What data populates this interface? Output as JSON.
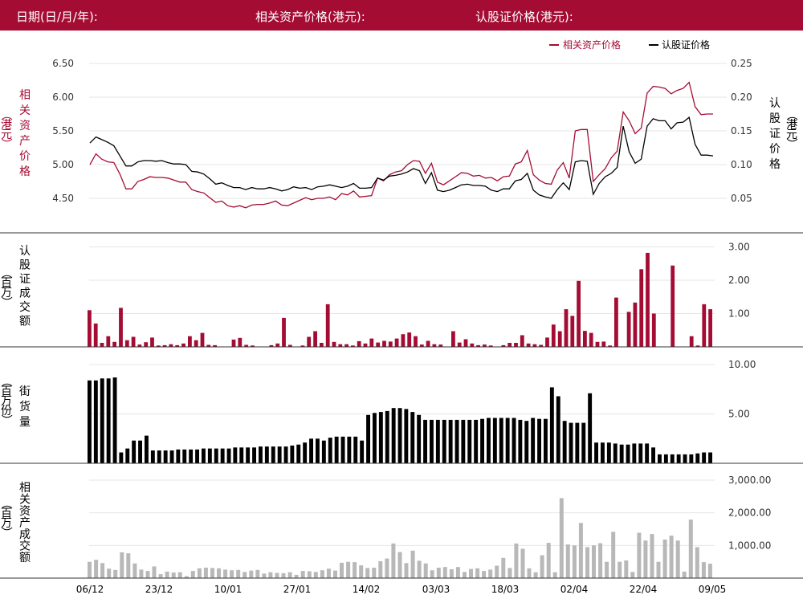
{
  "header": {
    "date_label": "日期(日/月/年):",
    "asset_price_label": "相关资产价格(港元):",
    "warrant_price_label": "认股证价格(港元):"
  },
  "colors": {
    "header_bg": "#a50c34",
    "asset": "#a50c34",
    "warrant": "#000000",
    "turnover_asset": "#b8b8b8",
    "grid": "#e6e6e6"
  },
  "chart_data": [
    {
      "type": "line",
      "title": "",
      "legend": [
        "相关资产价格",
        "认股证价格"
      ],
      "legend_position": "top-right",
      "ylabel_left": "相关资产价格（港元）",
      "ylabel_right": "认股证价格（港元）",
      "yticks_left": [
        "6.50",
        "6.00",
        "5.50",
        "5.00",
        "4.50"
      ],
      "yticks_right": [
        "0.25",
        "0.20",
        "0.15",
        "0.10",
        "0.05"
      ],
      "ylim_left": [
        4.2,
        6.6
      ],
      "ylim_right": [
        0.02,
        0.26
      ],
      "series": [
        {
          "name": "相关资产价格",
          "axis": "left",
          "color": "#a50c34",
          "values": [
            5.0,
            5.16,
            5.08,
            5.04,
            5.03,
            4.86,
            4.64,
            4.64,
            4.75,
            4.78,
            4.82,
            4.81,
            4.81,
            4.8,
            4.77,
            4.74,
            4.74,
            4.63,
            4.6,
            4.58,
            4.51,
            4.44,
            4.46,
            4.39,
            4.37,
            4.39,
            4.36,
            4.4,
            4.41,
            4.41,
            4.43,
            4.46,
            4.4,
            4.39,
            4.43,
            4.47,
            4.51,
            4.48,
            4.5,
            4.5,
            4.52,
            4.48,
            4.57,
            4.55,
            4.61,
            4.52,
            4.53,
            4.54,
            4.8,
            4.76,
            4.85,
            4.89,
            4.91,
            5.0,
            5.06,
            5.05,
            4.87,
            5.02,
            4.74,
            4.7,
            4.76,
            4.82,
            4.88,
            4.87,
            4.83,
            4.84,
            4.8,
            4.81,
            4.76,
            4.82,
            4.83,
            5.01,
            5.04,
            5.21,
            4.85,
            4.77,
            4.72,
            4.71,
            4.92,
            5.03,
            4.8,
            5.5,
            5.52,
            5.52,
            4.75,
            4.85,
            4.94,
            5.1,
            5.2,
            5.78,
            5.65,
            5.46,
            5.54,
            6.06,
            6.16,
            6.15,
            6.13,
            6.05,
            6.1,
            6.13,
            6.22,
            5.86,
            5.74,
            5.75,
            5.75
          ]
        },
        {
          "name": "认股证价格",
          "axis": "right",
          "color": "#000000",
          "values": [
            0.132,
            0.141,
            0.137,
            0.133,
            0.128,
            0.113,
            0.098,
            0.098,
            0.104,
            0.106,
            0.106,
            0.105,
            0.106,
            0.103,
            0.101,
            0.101,
            0.1,
            0.09,
            0.089,
            0.086,
            0.079,
            0.071,
            0.073,
            0.069,
            0.066,
            0.066,
            0.063,
            0.066,
            0.064,
            0.064,
            0.066,
            0.064,
            0.061,
            0.063,
            0.067,
            0.065,
            0.066,
            0.063,
            0.067,
            0.068,
            0.07,
            0.068,
            0.066,
            0.068,
            0.072,
            0.065,
            0.065,
            0.066,
            0.08,
            0.077,
            0.083,
            0.084,
            0.086,
            0.089,
            0.094,
            0.091,
            0.072,
            0.088,
            0.062,
            0.06,
            0.062,
            0.066,
            0.07,
            0.071,
            0.069,
            0.069,
            0.068,
            0.062,
            0.06,
            0.064,
            0.064,
            0.076,
            0.078,
            0.087,
            0.062,
            0.055,
            0.052,
            0.05,
            0.063,
            0.073,
            0.063,
            0.104,
            0.106,
            0.105,
            0.056,
            0.072,
            0.082,
            0.087,
            0.096,
            0.157,
            0.119,
            0.102,
            0.108,
            0.157,
            0.168,
            0.165,
            0.165,
            0.153,
            0.162,
            0.163,
            0.17,
            0.13,
            0.114,
            0.114,
            0.113
          ]
        }
      ]
    },
    {
      "type": "bar",
      "title": "",
      "ylabel": "认股证成交额（百万）",
      "yticks": [
        "3.00",
        "2.00",
        "1.00"
      ],
      "ylim": [
        0,
        3.3
      ],
      "color": "#a50c34",
      "values": [
        1.1,
        0.7,
        0.12,
        0.32,
        0.15,
        1.17,
        0.2,
        0.3,
        0.07,
        0.14,
        0.28,
        0.04,
        0.05,
        0.08,
        0.05,
        0.1,
        0.32,
        0.2,
        0.42,
        0.06,
        0.05,
        0.0,
        0.0,
        0.22,
        0.27,
        0.06,
        0.04,
        0.0,
        0.0,
        0.05,
        0.1,
        0.87,
        0.06,
        0.0,
        0.04,
        0.3,
        0.47,
        0.12,
        1.28,
        0.15,
        0.08,
        0.08,
        0.04,
        0.17,
        0.1,
        0.25,
        0.13,
        0.18,
        0.16,
        0.25,
        0.38,
        0.43,
        0.32,
        0.07,
        0.18,
        0.08,
        0.07,
        0.0,
        0.47,
        0.13,
        0.23,
        0.1,
        0.05,
        0.07,
        0.04,
        0.0,
        0.05,
        0.12,
        0.12,
        0.35,
        0.1,
        0.08,
        0.06,
        0.28,
        0.67,
        0.47,
        1.13,
        0.93,
        1.98,
        0.48,
        0.42,
        0.15,
        0.16,
        0.04,
        1.48,
        0.0,
        1.05,
        1.33,
        2.33,
        2.82,
        1.0,
        0.0,
        0.0,
        2.44,
        0.0,
        0.0,
        0.32,
        0.04,
        1.28,
        1.13
      ],
      "xcount": 95
    },
    {
      "type": "bar",
      "title": "",
      "ylabel": "街货量（百万份）",
      "yticks": [
        "10.00",
        "5.00"
      ],
      "ylim": [
        0,
        10.5
      ],
      "color": "#000000",
      "values": [
        8.4,
        8.4,
        8.6,
        8.6,
        8.7,
        1.1,
        1.5,
        2.3,
        2.3,
        2.8,
        1.3,
        1.3,
        1.3,
        1.3,
        1.4,
        1.4,
        1.4,
        1.4,
        1.5,
        1.5,
        1.5,
        1.5,
        1.5,
        1.6,
        1.6,
        1.6,
        1.6,
        1.7,
        1.7,
        1.7,
        1.7,
        1.7,
        1.8,
        1.9,
        2.1,
        2.5,
        2.5,
        2.3,
        2.6,
        2.7,
        2.7,
        2.7,
        2.7,
        2.3,
        4.9,
        5.1,
        5.2,
        5.3,
        5.6,
        5.6,
        5.5,
        5.2,
        4.9,
        4.4,
        4.4,
        4.4,
        4.4,
        4.4,
        4.4,
        4.4,
        4.4,
        4.4,
        4.5,
        4.6,
        4.6,
        4.6,
        4.6,
        4.6,
        4.4,
        4.3,
        4.6,
        4.5,
        4.5,
        7.7,
        6.8,
        4.3,
        4.1,
        4.1,
        4.1,
        7.1,
        2.1,
        2.1,
        2.1,
        2.0,
        1.9,
        1.9,
        2.0,
        2.0,
        2.0,
        1.6,
        0.9,
        0.9,
        0.9,
        0.9,
        0.9,
        0.9,
        1.0,
        1.1,
        1.1
      ]
    },
    {
      "type": "bar",
      "title": "",
      "ylabel": "相关资产成交额（百万）",
      "yticks": [
        "3,000.00",
        "2,000.00",
        "1,000.00"
      ],
      "ylim": [
        0,
        3000
      ],
      "color": "#b8b8b8",
      "xticks": [
        "06/12",
        "23/12",
        "10/01",
        "27/01",
        "14/02",
        "03/03",
        "18/03",
        "02/04",
        "22/04",
        "09/05"
      ],
      "values": [
        500,
        560,
        460,
        290,
        250,
        790,
        760,
        450,
        260,
        220,
        360,
        120,
        200,
        170,
        180,
        60,
        220,
        300,
        320,
        310,
        300,
        260,
        240,
        250,
        190,
        230,
        250,
        140,
        180,
        160,
        150,
        180,
        100,
        220,
        210,
        190,
        240,
        290,
        230,
        470,
        500,
        490,
        390,
        310,
        320,
        520,
        600,
        1060,
        800,
        460,
        840,
        530,
        450,
        240,
        320,
        340,
        270,
        340,
        190,
        280,
        300,
        220,
        260,
        380,
        620,
        310,
        1060,
        900,
        300,
        180,
        700,
        1080,
        180,
        2450,
        1030,
        1000,
        1690,
        950,
        1000,
        1070,
        500,
        1420,
        500,
        540,
        190,
        1390,
        1150,
        1350,
        500,
        1180,
        1300,
        1150,
        200,
        1790,
        950,
        490,
        440
      ]
    }
  ]
}
